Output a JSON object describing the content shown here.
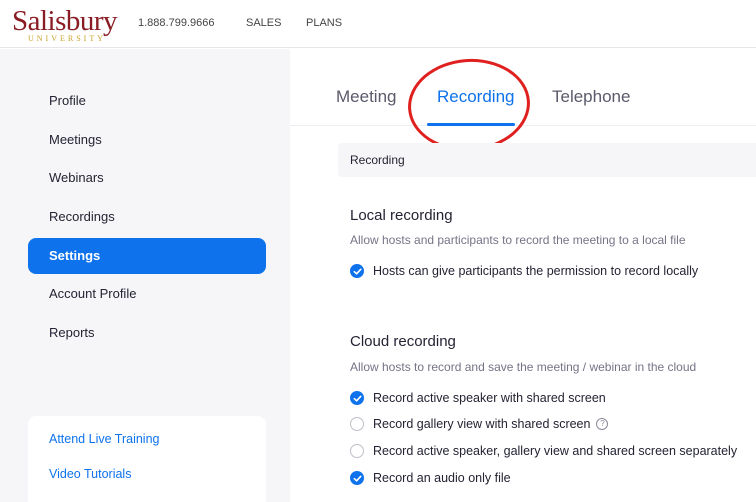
{
  "header": {
    "logo_text": "Salisbury",
    "logo_subtext": "UNIVERSITY",
    "phone": "1.888.799.9666",
    "links": [
      "SALES",
      "PLANS"
    ]
  },
  "sidebar": {
    "items": [
      {
        "label": "Profile"
      },
      {
        "label": "Meetings"
      },
      {
        "label": "Webinars"
      },
      {
        "label": "Recordings"
      },
      {
        "label": "Settings",
        "active": true
      },
      {
        "label": "Account Profile"
      },
      {
        "label": "Reports"
      }
    ],
    "help_links": [
      "Attend Live Training",
      "Video Tutorials"
    ]
  },
  "tabs": [
    {
      "label": "Meeting"
    },
    {
      "label": "Recording",
      "active": true
    },
    {
      "label": "Telephone"
    }
  ],
  "section_title": "Recording",
  "local_recording": {
    "title": "Local recording",
    "description": "Allow hosts and participants to record the meeting to a local file",
    "options": [
      {
        "label": "Hosts can give participants the permission to record locally",
        "checked": true
      }
    ]
  },
  "cloud_recording": {
    "title": "Cloud recording",
    "description": "Allow hosts to record and save the meeting / webinar in the cloud",
    "options": [
      {
        "label": "Record active speaker with shared screen",
        "checked": true
      },
      {
        "label": "Record gallery view with shared screen",
        "checked": false,
        "help_icon": "question-circle-icon"
      },
      {
        "label": "Record active speaker, gallery view and shared screen separately",
        "checked": false
      },
      {
        "label": "Record an audio only file",
        "checked": true
      }
    ]
  },
  "colors": {
    "accent": "#0e72ed",
    "brand": "#8a1c24",
    "annotation": "#e0201f"
  }
}
